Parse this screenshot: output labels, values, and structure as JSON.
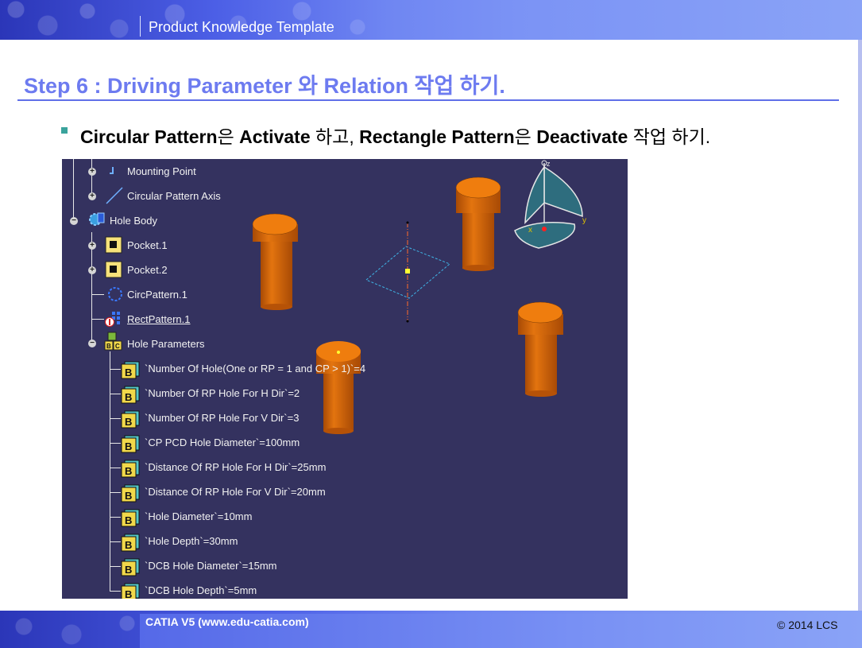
{
  "header": {
    "title": "Product Knowledge Template"
  },
  "slide": {
    "title": "Step 6 : Driving Parameter 와 Relation 작업 하기.",
    "bullet": {
      "p1": "Circular Pattern",
      "p2": "은 ",
      "p3": "Activate",
      "p4": " 하고, ",
      "p5": "Rectangle Pattern",
      "p6": "은 ",
      "p7": "Deactivate",
      "p8": " 작업 하기."
    }
  },
  "tree": {
    "items": [
      {
        "label": "Mounting Point",
        "icon": "point-icon"
      },
      {
        "label": "Circular Pattern Axis",
        "icon": "axis-line-icon"
      },
      {
        "label": "Hole Body",
        "icon": "body-gear-icon"
      },
      {
        "label": "Pocket.1",
        "icon": "pocket-icon"
      },
      {
        "label": "Pocket.2",
        "icon": "pocket-icon"
      },
      {
        "label": "CircPattern.1",
        "icon": "circular-pattern-icon"
      },
      {
        "label": "RectPattern.1",
        "icon": "rect-pattern-deactivated-icon"
      },
      {
        "label": "Hole Parameters",
        "icon": "parameters-set-icon"
      }
    ],
    "parameters": [
      "`Number Of Hole(One or RP = 1 and CP > 1)`=4",
      "`Number Of RP Hole For H Dir`=2",
      "`Number Of RP Hole For V Dir`=3",
      "`CP PCD Hole Diameter`=100mm",
      "`Distance Of RP Hole For H Dir`=25mm",
      "`Distance Of RP Hole For V Dir`=20mm",
      "`Hole Diameter`=10mm",
      "`Hole Depth`=30mm",
      "`DCB Hole Diameter`=15mm",
      "`DCB Hole Depth`=5mm"
    ]
  },
  "viewer": {
    "compass": {
      "x": "x",
      "y": "y",
      "z": "z"
    },
    "colors": {
      "background": "#34325f",
      "part": "#d96a0c",
      "compass": "#2e6d7e"
    }
  },
  "footer": {
    "left": "CATIA V5 (www.edu-catia.com)",
    "right": "© 2014 LCS"
  }
}
